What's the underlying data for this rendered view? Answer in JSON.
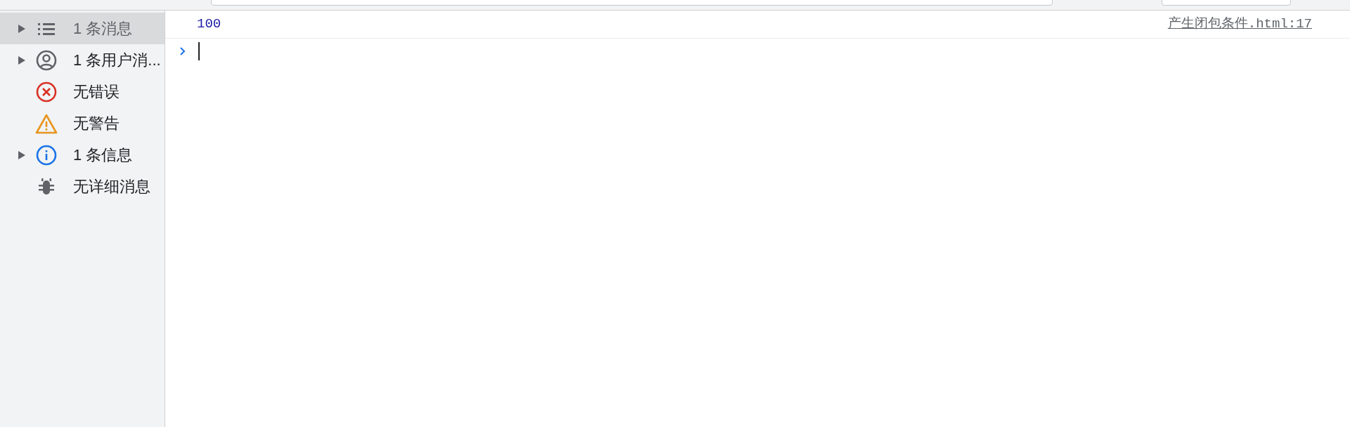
{
  "sidebar": {
    "items": [
      {
        "kind": "list",
        "label": "1 条消息",
        "expandable": true,
        "selected": true
      },
      {
        "kind": "user",
        "label": "1 条用户消...",
        "expandable": true,
        "selected": false
      },
      {
        "kind": "error",
        "label": "无错误",
        "expandable": false,
        "selected": false
      },
      {
        "kind": "warning",
        "label": "无警告",
        "expandable": false,
        "selected": false
      },
      {
        "kind": "info",
        "label": "1 条信息",
        "expandable": true,
        "selected": false
      },
      {
        "kind": "verbose",
        "label": "无详细消息",
        "expandable": false,
        "selected": false
      }
    ]
  },
  "console": {
    "messages": [
      {
        "text": "100",
        "source": "产生闭包条件.html:17"
      }
    ]
  }
}
